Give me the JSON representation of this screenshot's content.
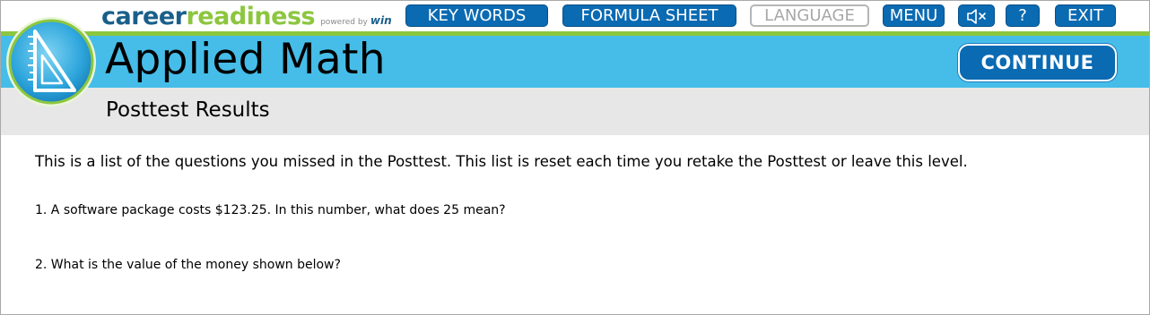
{
  "brand": {
    "career": "career",
    "readiness": "readiness",
    "powered_by": "powered by",
    "win": "win"
  },
  "nav": {
    "key_words": "KEY WORDS",
    "formula_sheet": "FORMULA SHEET",
    "language": "LANGUAGE",
    "menu": "MENU",
    "audio_icon": "speaker-mute-icon",
    "help": "?",
    "exit": "EXIT"
  },
  "header": {
    "title": "Applied Math",
    "continue_label": "CONTINUE",
    "subtitle": "Posttest Results",
    "logo_icon": "triangle-ruler-icon"
  },
  "main": {
    "intro": "This is a list of the questions you missed in the Posttest. This list is reset each time you retake the Posttest or leave this level.",
    "questions": [
      "1. A software package costs $123.25. In this number, what does 25 mean?",
      "2. What is the value of the money shown below?"
    ]
  },
  "colors": {
    "nav_button": "#0a6ab2",
    "title_band": "#45bde8",
    "accent_green": "#8cc63f",
    "sub_band": "#e7e7e7",
    "brand_blue": "#1a5f8a"
  }
}
